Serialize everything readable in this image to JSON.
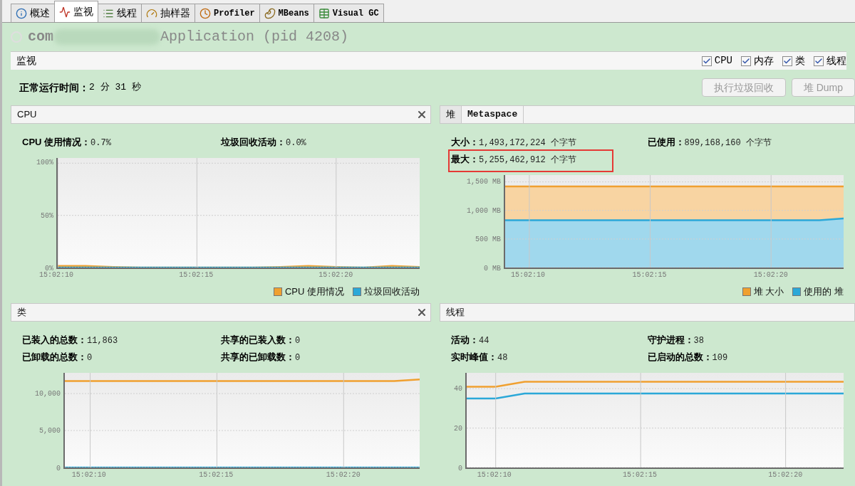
{
  "tabs": [
    {
      "label": "概述",
      "kind": "info",
      "selected": false
    },
    {
      "label": "监视",
      "kind": "monitor",
      "selected": true
    },
    {
      "label": "线程",
      "kind": "threads",
      "selected": false
    },
    {
      "label": "抽样器",
      "kind": "sampler",
      "selected": false
    },
    {
      "label": "Profiler",
      "kind": "profiler",
      "selected": false
    },
    {
      "label": "MBeans",
      "kind": "mbeans",
      "selected": false
    },
    {
      "label": "Visual GC",
      "kind": "gc",
      "selected": false
    }
  ],
  "app_title": {
    "prefix": "com",
    "name": "Application (pid 4208)",
    "redacted": true
  },
  "monitor_bar": {
    "title": "监视",
    "checkboxes": [
      {
        "label": "CPU",
        "checked": true
      },
      {
        "label": "内存",
        "checked": true
      },
      {
        "label": "类",
        "checked": true
      },
      {
        "label": "线程",
        "checked": true
      }
    ]
  },
  "uptime": {
    "label": "正常运行时间：",
    "value": "2 分 31 秒"
  },
  "buttons": [
    {
      "label": "执行垃圾回收",
      "disabled": true
    },
    {
      "label": "堆 Dump",
      "disabled": true
    }
  ],
  "panels": [
    {
      "title": "CPU",
      "closable": true,
      "legend": true,
      "stats": [
        {
          "label": "CPU 使用情况：",
          "value": "0.7%",
          "highlighted": false
        },
        {
          "label": "垃圾回收活动：",
          "value": "0.0%",
          "highlighted": false
        }
      ],
      "chart_data": {
        "type": "line",
        "grid": true,
        "categories": [
          "15:02:10",
          null,
          null,
          null,
          null,
          "15:02:15",
          null,
          null,
          null,
          null,
          "15:02:20",
          null,
          null,
          null
        ],
        "ylim": [
          0,
          105
        ],
        "yticks": [
          {
            "value": 0,
            "label": "0%"
          },
          {
            "value": 50,
            "label": "50%"
          },
          {
            "value": 100,
            "label": "100%"
          }
        ],
        "series": [
          {
            "name": "CPU 使用情况",
            "color": "#f0a030",
            "values": [
              1.5,
              1.5,
              0.5,
              0,
              0,
              0,
              0,
              0,
              0.5,
              1.5,
              0.5,
              0,
              1.5,
              0.5
            ]
          },
          {
            "name": "垃圾回收活动",
            "color": "#2ba8d8",
            "values": [
              0,
              0,
              0,
              0,
              0,
              0,
              0,
              0,
              0,
              0,
              0,
              0,
              0,
              0
            ]
          }
        ]
      }
    },
    {
      "tabs": [
        {
          "label": "堆",
          "selected": true
        },
        {
          "label": "Metaspace",
          "selected": false
        }
      ],
      "closable": false,
      "legend": true,
      "stats": [
        {
          "label": "大小：",
          "value": "1,493,172,224 个字节",
          "highlighted": false
        },
        {
          "label": "已使用：",
          "value": "899,168,160 个字节",
          "highlighted": false
        },
        {
          "label": "最大：",
          "value": "5,255,462,912 个字节",
          "highlighted": true
        }
      ],
      "chart_data": {
        "type": "area",
        "grid": true,
        "categories": [
          null,
          "15:02:10",
          null,
          null,
          null,
          null,
          "15:02:15",
          null,
          null,
          null,
          null,
          "15:02:20",
          null,
          null,
          null
        ],
        "ylim": [
          0,
          1620
        ],
        "yticks": [
          {
            "value": 0,
            "label": "0 MB"
          },
          {
            "value": 500,
            "label": "500 MB"
          },
          {
            "value": 1000,
            "label": "1,000 MB"
          },
          {
            "value": 1500,
            "label": "1,500 MB"
          }
        ],
        "series": [
          {
            "name": "堆 大小",
            "color": "#f0a030",
            "values": [
              1420,
              1420,
              1420,
              1420,
              1420,
              1420,
              1420,
              1420,
              1420,
              1420,
              1420,
              1420,
              1420,
              1420,
              1420
            ]
          },
          {
            "name": "使用的 堆",
            "color": "#2ba8d8",
            "values": [
              830,
              830,
              830,
              830,
              830,
              830,
              830,
              830,
              830,
              830,
              830,
              830,
              830,
              830,
              860
            ]
          }
        ]
      }
    },
    {
      "title": "类",
      "closable": true,
      "legend": false,
      "stats": [
        {
          "label": "已装入的总数：",
          "value": "11,863",
          "highlighted": false
        },
        {
          "label": "共享的已装入数：",
          "value": "0",
          "highlighted": false
        },
        {
          "label": "已卸载的总数：",
          "value": "0",
          "highlighted": false
        },
        {
          "label": "共享的已卸载数：",
          "value": "0",
          "highlighted": false
        }
      ],
      "chart_data": {
        "type": "line",
        "grid": true,
        "categories": [
          null,
          "15:02:10",
          null,
          null,
          null,
          null,
          "15:02:15",
          null,
          null,
          null,
          null,
          "15:02:20",
          null,
          null,
          null
        ],
        "ylim": [
          0,
          12800
        ],
        "yticks": [
          {
            "value": 0,
            "label": "0"
          },
          {
            "value": 5000,
            "label": "5,000"
          },
          {
            "value": 10000,
            "label": "10,000"
          }
        ],
        "series": [
          {
            "color": "#f0a030",
            "values": [
              11700,
              11700,
              11700,
              11700,
              11700,
              11700,
              11700,
              11700,
              11700,
              11700,
              11700,
              11700,
              11700,
              11700,
              11900
            ]
          },
          {
            "color": "#2ba8d8",
            "values": [
              0,
              0,
              0,
              0,
              0,
              0,
              0,
              0,
              0,
              0,
              0,
              0,
              0,
              0,
              0
            ]
          }
        ]
      }
    },
    {
      "title": "线程",
      "closable": false,
      "legend": false,
      "stats": [
        {
          "label": "活动：",
          "value": "44",
          "highlighted": false
        },
        {
          "label": "守护进程：",
          "value": "38",
          "highlighted": false
        },
        {
          "label": "实时峰值：",
          "value": "48",
          "highlighted": false
        },
        {
          "label": "已启动的总数：",
          "value": "109",
          "highlighted": false
        }
      ],
      "chart_data": {
        "type": "line",
        "grid": true,
        "categories": [
          null,
          "15:02:10",
          null,
          null,
          null,
          null,
          "15:02:15",
          null,
          null,
          null,
          null,
          "15:02:20",
          null,
          null
        ],
        "ylim": [
          0,
          48
        ],
        "yticks": [
          {
            "value": 0,
            "label": "0"
          },
          {
            "value": 20,
            "label": "20"
          },
          {
            "value": 40,
            "label": "40"
          }
        ],
        "series": [
          {
            "color": "#f0a030",
            "values": [
              41,
              41,
              43.5,
              43.5,
              43.5,
              43.5,
              43.5,
              43.5,
              43.5,
              43.5,
              43.5,
              43.5,
              43.5,
              43.5
            ]
          },
          {
            "color": "#2ba8d8",
            "values": [
              35,
              35,
              37.5,
              37.5,
              37.5,
              37.5,
              37.5,
              37.5,
              37.5,
              37.5,
              37.5,
              37.5,
              37.5,
              37.5
            ]
          }
        ]
      }
    }
  ]
}
